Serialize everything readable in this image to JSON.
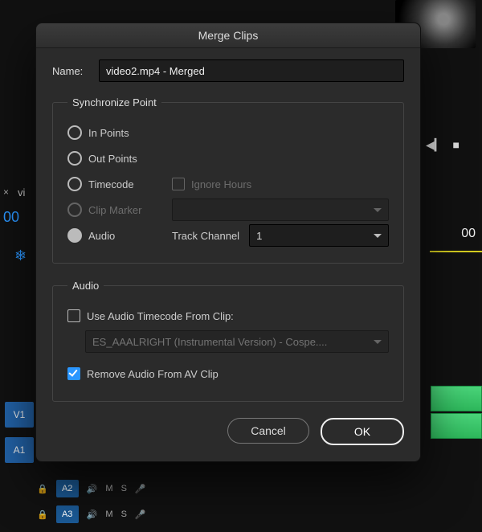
{
  "dialog": {
    "title": "Merge Clips",
    "name_label": "Name:",
    "name_value": "video2.mp4 - Merged",
    "sync": {
      "legend": "Synchronize Point",
      "in_points": "In Points",
      "out_points": "Out Points",
      "timecode": "Timecode",
      "ignore_hours": "Ignore Hours",
      "clip_marker": "Clip Marker",
      "audio": "Audio",
      "track_channel_label": "Track Channel",
      "track_channel_value": "1",
      "selected": "audio"
    },
    "audio": {
      "legend": "Audio",
      "use_timecode": "Use Audio Timecode From Clip:",
      "clip_dropdown": "ES_AAALRIGHT (Instrumental Version) - Cospe....",
      "remove_audio": "Remove Audio From AV Clip",
      "remove_audio_checked": true
    },
    "buttons": {
      "cancel": "Cancel",
      "ok": "OK"
    }
  },
  "background": {
    "sequence_tab_close": "×",
    "sequence_tab": "vi",
    "timecode_left": "00",
    "snap_icon": "❄",
    "timecode_right": "00",
    "tracks": {
      "v1": "V1",
      "a1": "A1",
      "a2": "A2",
      "a3": "A3"
    },
    "track_controls": {
      "m": "M",
      "s": "S",
      "mic": "🎤",
      "lock": "🔒",
      "speaker": "🔊"
    },
    "playback": {
      "prev": "◀▎",
      "stop": "■"
    }
  }
}
